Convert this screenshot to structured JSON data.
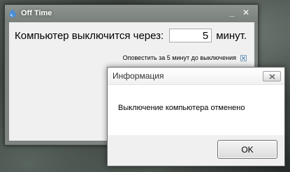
{
  "main_window": {
    "title": "Off Time",
    "minimize_label": "_",
    "close_label": "✕",
    "shutdown_prefix": "Компьютер выключится через:",
    "minutes_value": "5",
    "minutes_unit": "минут.",
    "notify_label": "Оповестить за 5 минут до выключения",
    "notify_checked": true
  },
  "dialog": {
    "title": "Информация",
    "message": "Выключение компьютера отменено",
    "ok_label": "OK"
  },
  "icons": {
    "app": "water-drop-icon",
    "close": "close-icon",
    "check": "check-icon"
  },
  "colors": {
    "app_icon": "#4a8fd8",
    "close_x": "#6a6a6a"
  }
}
